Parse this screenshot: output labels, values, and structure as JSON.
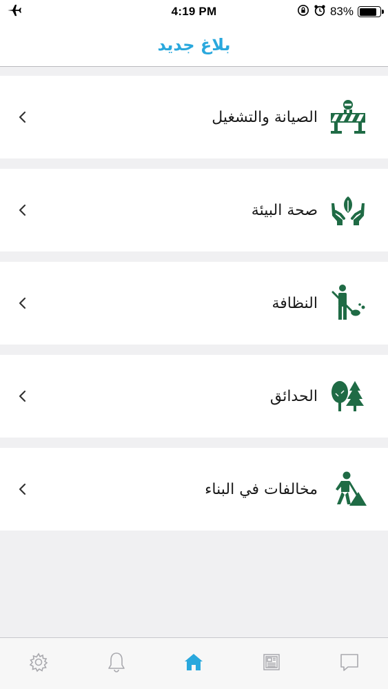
{
  "status_bar": {
    "time": "4:19 PM",
    "battery_percent": "83%",
    "battery_level": 0.83,
    "left_icon": "airplane-icon",
    "right_icons": [
      "orientation-lock-icon",
      "alarm-icon",
      "battery-icon"
    ]
  },
  "nav": {
    "title": "بلاغ جديد"
  },
  "categories": [
    {
      "label": "الصيانة والتشغيل",
      "icon": "road-barrier-icon"
    },
    {
      "label": "صحة البيئة",
      "icon": "hands-leaf-icon"
    },
    {
      "label": "النظافة",
      "icon": "street-sweeper-icon"
    },
    {
      "label": "الحدائق",
      "icon": "trees-icon"
    },
    {
      "label": "مخالفات في البناء",
      "icon": "construction-worker-icon"
    }
  ],
  "tabs": [
    {
      "icon": "gear-icon",
      "active": false
    },
    {
      "icon": "bell-icon",
      "active": false
    },
    {
      "icon": "home-icon",
      "active": true
    },
    {
      "icon": "newspaper-icon",
      "active": false
    },
    {
      "icon": "chat-icon",
      "active": false
    }
  ],
  "colors": {
    "accent": "#2aa8dd",
    "icon_green": "#1f6b45",
    "tab_inactive": "#a9a9ae",
    "background": "#f0f0f2"
  }
}
